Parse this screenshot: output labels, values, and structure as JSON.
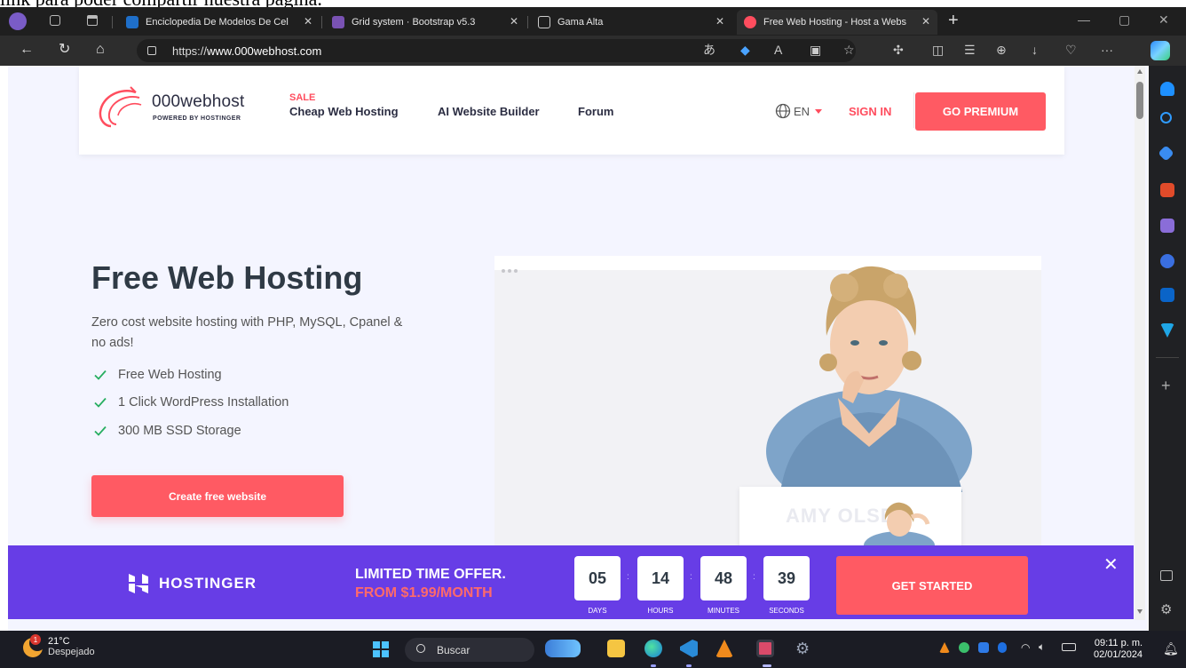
{
  "top_cut_text": "link para poder compartir nuestra pagina.",
  "browser": {
    "tabs": [
      {
        "label": "Enciclopedia De Modelos De Cel",
        "active": false
      },
      {
        "label": "Grid system · Bootstrap v5.3",
        "active": false
      },
      {
        "label": "Gama Alta",
        "active": false
      },
      {
        "label": "Free Web Hosting - Host a Webs",
        "active": true
      }
    ],
    "new_tab": "+",
    "url_prefix": "https://",
    "url_host": "www.000webhost.com",
    "win_min": "—",
    "win_max": "▢",
    "win_close": "✕"
  },
  "site": {
    "logo_name": "000webhost",
    "logo_sub": "POWERED BY HOSTINGER",
    "sale_badge": "SALE",
    "nav": {
      "cheap_hosting": "Cheap Web Hosting",
      "ai_builder": "AI Website Builder",
      "forum": "Forum"
    },
    "lang": "EN",
    "sign_in": "SIGN IN",
    "go_premium": "GO PREMIUM"
  },
  "hero": {
    "title": "Free Web Hosting",
    "subtitle": "Zero cost website hosting with PHP, MySQL, Cpanel & no ads!",
    "features": [
      "Free Web Hosting",
      "1 Click WordPress Installation",
      "300 MB SSD Storage"
    ],
    "cta": "Create free website",
    "mini_card_name": "AMY OLSEN"
  },
  "promo": {
    "brand": "HOSTINGER",
    "offer_line1": "LIMITED TIME OFFER.",
    "offer_line2": "FROM $1.99/MONTH",
    "countdown": [
      {
        "value": "05",
        "label": "DAYS"
      },
      {
        "value": "14",
        "label": "HOURS"
      },
      {
        "value": "48",
        "label": "MINUTES"
      },
      {
        "value": "39",
        "label": "SECONDS"
      }
    ],
    "button": "GET STARTED",
    "close": "✕"
  },
  "taskbar": {
    "temperature": "21°C",
    "condition": "Despejado",
    "notification_count": "1",
    "search_placeholder": "Buscar",
    "time": "09:11 p. m.",
    "date": "02/01/2024"
  },
  "colors": {
    "brand_red": "#ff5a63",
    "promo_purple": "#673de6",
    "heading": "#2f3a45"
  }
}
